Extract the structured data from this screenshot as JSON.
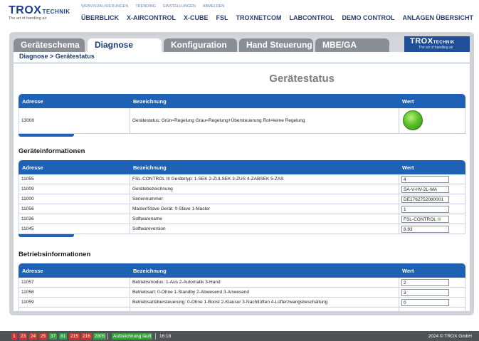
{
  "header": {
    "logo_text": "TROX",
    "logo_sub": "TECHNIK",
    "logo_tagline": "The art of handling air",
    "subnav": [
      "WEBVISUALISIERUNGEN",
      "TRENDING",
      "EINSTELLUNGEN",
      "ABMELDEN"
    ],
    "mainnav": [
      "ÜBERBLICK",
      "X-AIRCONTROL",
      "X-CUBE",
      "FSL",
      "TROXNETCOM",
      "LABCONTROL",
      "DEMO CONTROL",
      "ANLAGEN ÜBERSICHT"
    ]
  },
  "tabs": [
    {
      "label": "Geräteschema",
      "active": false
    },
    {
      "label": "Diagnose",
      "active": true
    },
    {
      "label": "Konfiguration",
      "active": false
    },
    {
      "label": "Hand Steuerung",
      "active": false
    },
    {
      "label": "MBE/GA",
      "active": false
    }
  ],
  "brand_box": {
    "title": "TROX",
    "sub": "TECHNIK",
    "tagline": "The art of handling air"
  },
  "breadcrumb": "Diagnose > Gerätestatus",
  "page_title": "Gerätestatus",
  "columns": {
    "address": "Adresse",
    "description": "Bezeichnung",
    "value": "Wert"
  },
  "status_table": {
    "rows": [
      {
        "address": "13000",
        "description": "Gerätestatus: Grün=Regelung Grau=Regelung+Übersteuerung Rot=keine Regelung",
        "lamp_color": "#5cc22a"
      }
    ]
  },
  "device_info": {
    "title": "Geräteinformationen",
    "rows": [
      {
        "address": "11055",
        "description": "FSL-CONTROL III Gerätetyp: 1-SEK 2-ZULSEK 3-ZUS 4-ZABSEK 5-ZAS",
        "value": "4"
      },
      {
        "address": "11009",
        "description": "Gerätebezeichnung",
        "value": "SA-V-HV-2L-MA"
      },
      {
        "address": "11000",
        "description": "Seriennummer",
        "value": "DE1762752080001"
      },
      {
        "address": "11056",
        "description": "Master/Slave Gerät: 0-Slave 1-Master",
        "value": "1"
      },
      {
        "address": "11036",
        "description": "Softwarename",
        "value": "FSL-CONTROL III"
      },
      {
        "address": "11045",
        "description": "Softwareversion",
        "value": "8.83"
      }
    ]
  },
  "operation_info": {
    "title": "Betriebsinformationen",
    "rows": [
      {
        "address": "11057",
        "description": "Betriebsmodus: 1-Aus 2-Automatik 3-Hand",
        "value": "2"
      },
      {
        "address": "11058",
        "description": "Betriebsart: 0-Ohne 1-Standby 2-Abwesend 3-Anwesend",
        "value": "3"
      },
      {
        "address": "11059",
        "description": "Betriebsartübersteuerung: 0-Ohne 1-Boost 2-Klausur 3-Nachtlüften 4-Lüfterzwangsbeschaltung",
        "value": "0"
      }
    ]
  },
  "statusbar": {
    "red_chips": [
      "1",
      "23",
      "24",
      "25"
    ],
    "green_chips": [
      "37",
      "81"
    ],
    "red_chips2": [
      "215",
      "216"
    ],
    "green_chips2": [
      "2805"
    ],
    "recording": "Aufzeichnung läuft",
    "time": "16:18",
    "copyright": "2024 © TROX GmbH"
  }
}
